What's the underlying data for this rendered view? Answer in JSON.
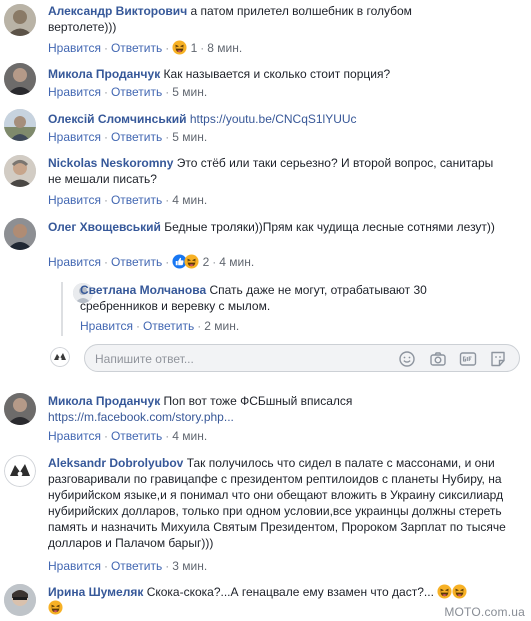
{
  "common": {
    "like": "Нравится",
    "reply": "Ответить",
    "dot": "·"
  },
  "comments": [
    {
      "author": "Александр Викторович",
      "text": "а патом прилетел волшебник в голубом вертолете)))",
      "reaction_count": "1",
      "time": "8 мин."
    },
    {
      "author": "Микола Проданчук",
      "text": "Как называется и сколько стоит порция?",
      "time": "5 мин."
    },
    {
      "author": "Олексій Сломчинський",
      "link": "https://youtu.be/CNCqS1lYUUc",
      "time": "5 мин."
    },
    {
      "author": "Nickolas Neskoromny",
      "text": "Это стёб или таки серьезно? И второй вопрос, санитары не мешали писать?",
      "time": "4 мин."
    },
    {
      "author": "Олег Хвощевський",
      "text": "Бедные троляки))Прям как чудища лесные сотнями лезут))",
      "reaction_count": "2",
      "time": "4 мин."
    },
    {
      "author": "Микола Проданчук",
      "text": "Поп вот тоже ФСБшный вписался",
      "link": "https://m.facebook.com/story.php...",
      "time": "4 мин."
    },
    {
      "author": "Aleksandr Dobrolyubov",
      "text": "Так получилось что сидел в палате с массонами, и они разговаривали по гравицапфе с президентом рептилоидов с планеты Нубиру, на нубирийском языке,и я понимал что они обещают вложить в Украину сиксилиард нубирийских долларов, только при одном условии,все украинцы должны стереть память и назначить Михуила Святым Президентом, Пророком Зарплат по тысяче долларов и Палачом барыг)))",
      "time": "3 мин."
    },
    {
      "author": "Ирина Шумеляк",
      "text": "Скока-скока?...А генацвале ему взамен что даст?..."
    }
  ],
  "reply": {
    "author": "Светлана Молчанова",
    "text": "Спать даже не могут, отрабатывают 30 сребренников и веревку с мылом.",
    "time": "2 мин."
  },
  "reply_input": {
    "placeholder": "Напишите ответ..."
  },
  "watermark": "MOTO.com.ua",
  "icons": [
    "emoji-icon",
    "camera-icon",
    "gif-icon",
    "sticker-icon",
    "laugh-reaction-icon",
    "like-reaction-icon"
  ],
  "colors": {
    "author": "#365899",
    "action_link": "#4267b2",
    "meta": "#616770",
    "input_bg": "#f2f3f5",
    "like_blue": "#1877f2",
    "haha_yellow": "#f7b125"
  }
}
